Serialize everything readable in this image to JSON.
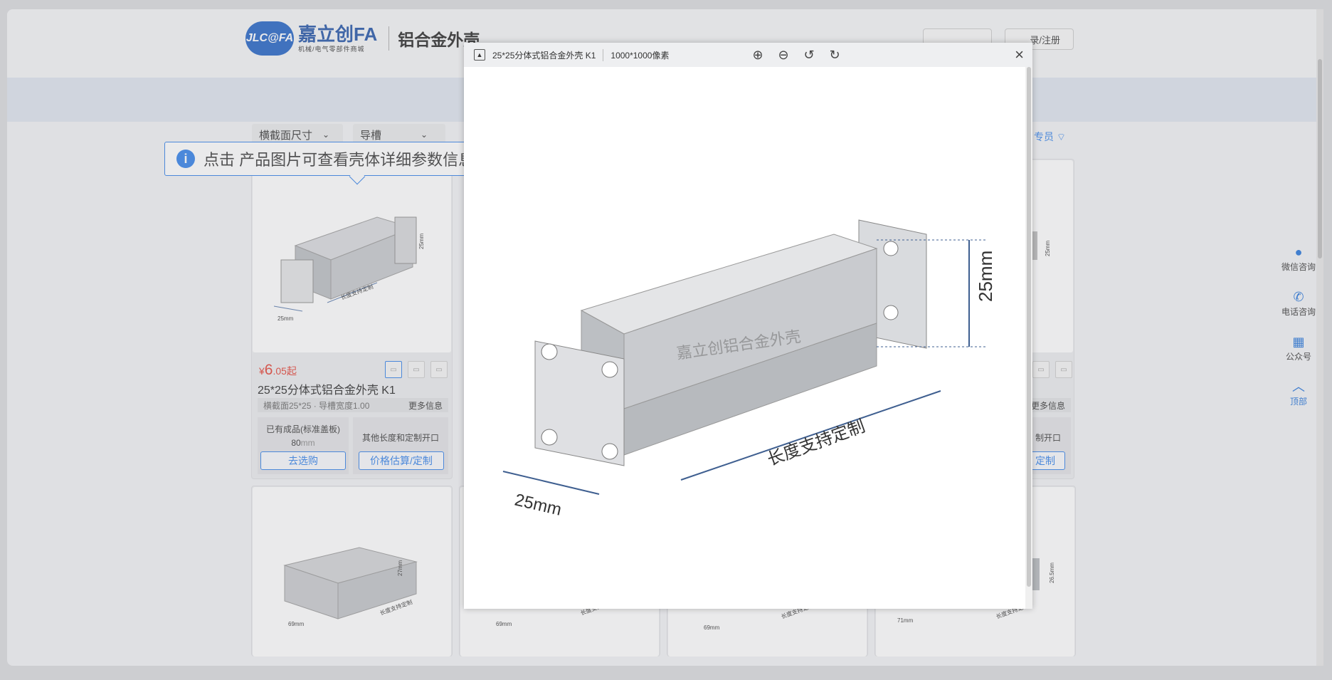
{
  "header": {
    "logo_mark": "JLC@FA",
    "logo_name": "嘉立创FA",
    "logo_sub": "机械/电气零部件商城",
    "page_title": "铝合金外壳",
    "login_label": "录/注册"
  },
  "filters": [
    {
      "label": "横截面尺寸"
    },
    {
      "label": "导槽"
    }
  ],
  "filter_right_text": "专员",
  "tooltip": {
    "icon": "i",
    "text": "点击 产品图片可查看壳体详细参数信息"
  },
  "product": {
    "price_symbol": "¥",
    "price_int": "6",
    "price_dec": ".05起",
    "name": "25*25分体式铝合金外壳 K1",
    "spec": "横截面25*25 · 导槽宽度1.00",
    "more": "更多信息",
    "option1_title": "已有成品(标准盖板)",
    "option1_value": "80",
    "option1_unit": "mm",
    "option2_title": "其他长度和定制开口",
    "btn_buy": "去选购",
    "btn_custom": "价格估算/定制"
  },
  "right_card_partial": {
    "more": "更多信息",
    "option2_title": "制开口",
    "btn_custom": "定制"
  },
  "image_labels": {
    "card1_height": "25mm",
    "card1_width": "25mm",
    "card1_length": "长度支持定制",
    "card5_height": "27mm",
    "card5_width": "69mm",
    "card5_length": "长度支持定制",
    "card6_width": "69mm",
    "card6_length": "长度支持定制",
    "card7_width": "69mm",
    "card7_length": "长度支持定制",
    "card8_height": "26.5mm",
    "card8_width": "71mm",
    "card8_length": "长度支持定制",
    "right_height": "25mm"
  },
  "sidebar": [
    {
      "label": "微信咨询",
      "icon": "wechat-icon"
    },
    {
      "label": "电话咨询",
      "icon": "phone-icon"
    },
    {
      "label": "公众号",
      "icon": "qr-icon"
    },
    {
      "label": "顶部",
      "icon": "chevron-up-icon"
    }
  ],
  "viewer": {
    "title": "25*25分体式铝合金外壳 K1",
    "dimensions": "1000*1000像素",
    "tools": [
      "zoom-in-icon",
      "zoom-out-icon",
      "rotate-left-icon",
      "rotate-right-icon"
    ],
    "close": "×",
    "img_height_label": "25mm",
    "img_width_label": "25mm",
    "img_length_label": "长度支持定制",
    "img_watermark": "嘉立创铝合金外壳"
  },
  "colors": {
    "accent": "#2b7de9",
    "price": "#e23b2e",
    "brand": "#1c4fa5"
  }
}
